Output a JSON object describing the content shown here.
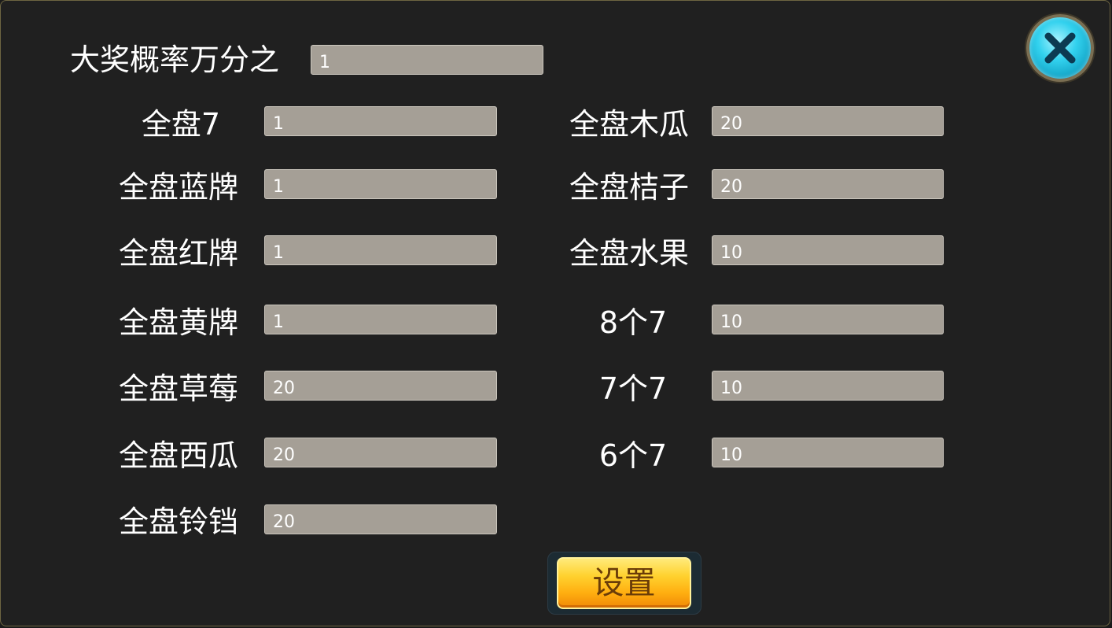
{
  "header": {
    "grand_prize_label": "大奖概率万分之",
    "grand_prize_value": "1"
  },
  "left_column": [
    {
      "label": "全盘7",
      "value": "1"
    },
    {
      "label": "全盘蓝牌",
      "value": "1"
    },
    {
      "label": "全盘红牌",
      "value": "1"
    },
    {
      "label": "全盘黄牌",
      "value": "1"
    },
    {
      "label": "全盘草莓",
      "value": "20"
    },
    {
      "label": "全盘西瓜",
      "value": "20"
    },
    {
      "label": "全盘铃铛",
      "value": "20"
    }
  ],
  "right_column": [
    {
      "label": "全盘木瓜",
      "value": "20"
    },
    {
      "label": "全盘桔子",
      "value": "20"
    },
    {
      "label": "全盘水果",
      "value": "10"
    },
    {
      "label": "8个7",
      "value": "10"
    },
    {
      "label": "7个7",
      "value": "10"
    },
    {
      "label": "6个7",
      "value": "10"
    }
  ],
  "actions": {
    "set_label": "设置",
    "close_icon": "close-x-icon"
  },
  "colors": {
    "panel_bg": "#202020",
    "field_bg": "#a59f96",
    "button_orange": "#ffae10",
    "close_cyan": "#32d1ee"
  }
}
